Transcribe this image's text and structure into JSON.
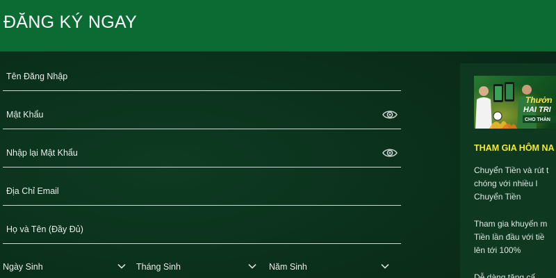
{
  "header": {
    "title": "ĐĂNG KÝ NGAY"
  },
  "form": {
    "username": {
      "label": "Tên Đăng Nhập"
    },
    "password": {
      "label": "Mật Khẩu"
    },
    "confirm_password": {
      "label": "Nhập lại Mật Khẩu"
    },
    "email": {
      "label": "Địa Chỉ Email"
    },
    "full_name": {
      "label": "Họ và Tên (Đầy Đủ)"
    },
    "birth_day": {
      "label": "Ngày Sinh"
    },
    "birth_month": {
      "label": "Tháng Sinh"
    },
    "birth_year": {
      "label": "Năm Sinh"
    }
  },
  "promo": {
    "banner_line1": "Thưởn",
    "banner_line2": "HAI TRI",
    "banner_line3": "CHO THÀN",
    "heading": "THAM GIA HÔM NA",
    "p1_line1": "Chuyển Tiền và rút t",
    "p1_line2": "chóng   với   nhiều   l",
    "p1_line3": "Chuyển Tiền",
    "p2_line1": "Tham gia khuyến m",
    "p2_line2": "Tiền  lần  đầu  với  tiề",
    "p2_line3": "lên tới 100%",
    "p3_line1": "Dễ  dàng  tăng  cấ"
  },
  "colors": {
    "header_bg": "#0b6b33",
    "page_bg": "#0a2e1a",
    "promo_heading": "#f2ec2f"
  },
  "icons": {
    "password_toggle": "eye-icon",
    "confirm_toggle": "eye-icon",
    "select_arrow": "chevron-down-icon"
  }
}
